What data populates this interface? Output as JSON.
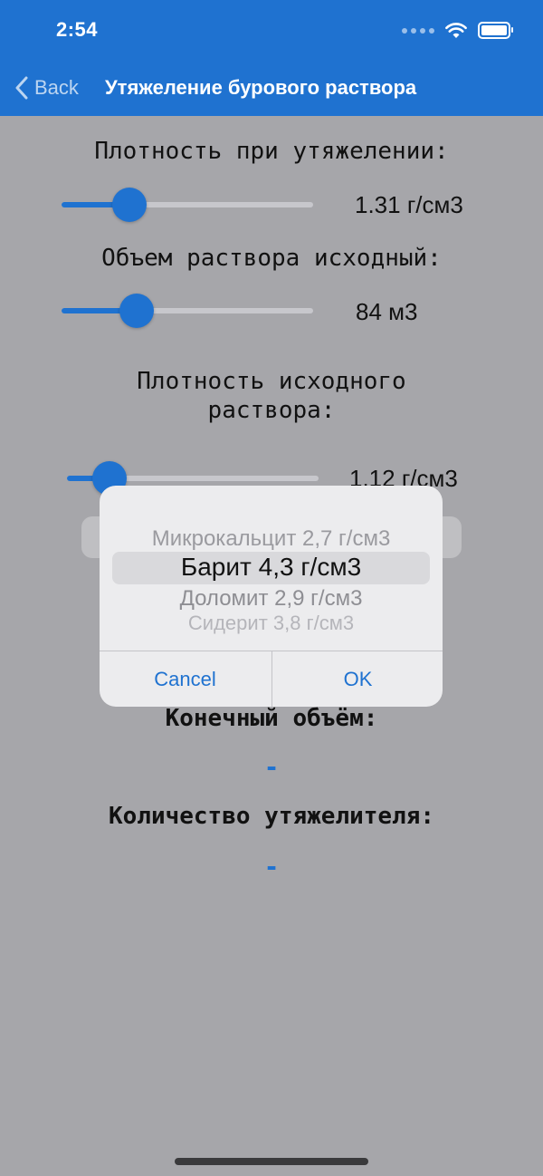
{
  "status_bar": {
    "time": "2:54"
  },
  "nav": {
    "back_label": "Back",
    "title": "Утяжеление бурового раствора"
  },
  "form": {
    "weighted_density": {
      "label": "Плотность при утяжелении:",
      "value": "1.31 г/см3",
      "fraction": 0.27
    },
    "initial_volume": {
      "label": "Объем раствора исходный:",
      "value": "84 м3",
      "fraction": 0.3
    },
    "initial_density": {
      "label_line1": "Плотность исходного",
      "label_line2": "раствора:",
      "value": "1.12 г/см3",
      "fraction": 0.17
    }
  },
  "results": {
    "final_volume_label": "Конечный объём:",
    "final_volume_value": "-",
    "weighting_amount_label": "Количество утяжелителя:",
    "weighting_amount_value": "-"
  },
  "picker_alert": {
    "options": [
      "Микрокальцит 2,7 г/см3",
      "Барит 4,3 г/см3",
      "Доломит 2,9 г/см3",
      "Сидерит 3,8 г/см3"
    ],
    "selected": "Барит 4,3 г/см3",
    "cancel_label": "Cancel",
    "ok_label": "OK"
  },
  "colors": {
    "accent": "#1f72d0",
    "background": "#a6a6aa",
    "alert": "#ececee"
  }
}
